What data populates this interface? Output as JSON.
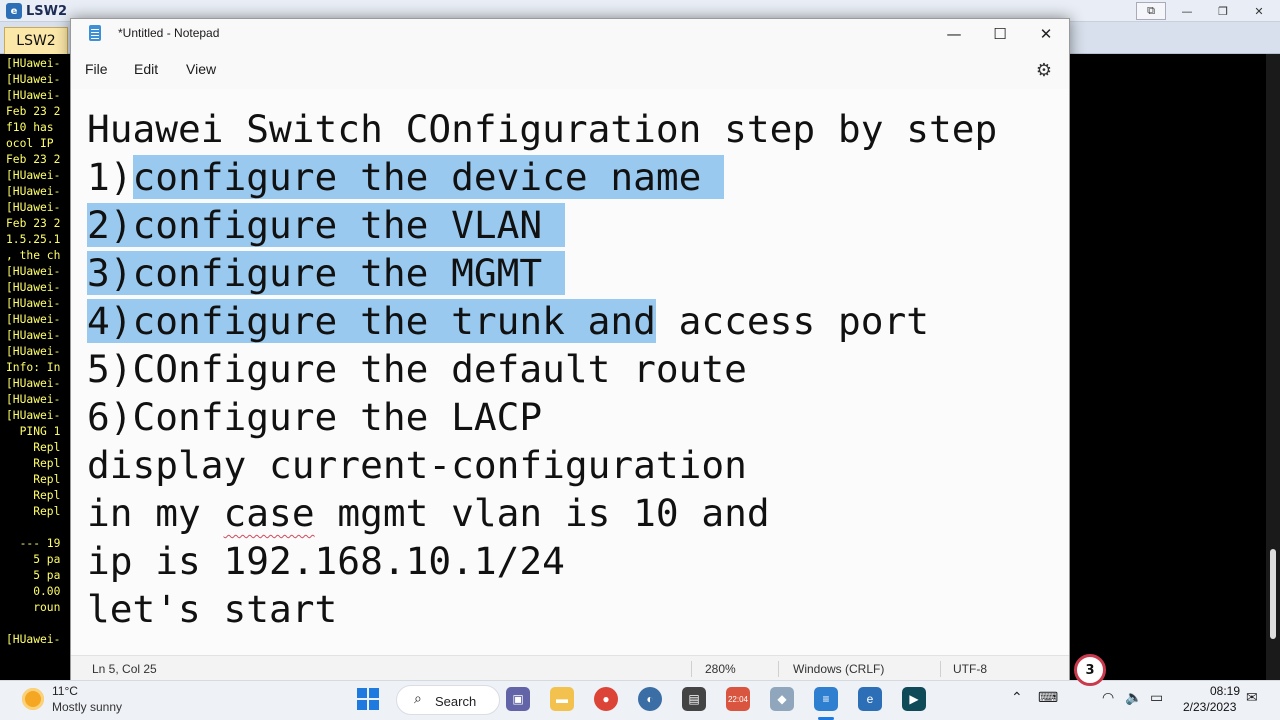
{
  "background_window": {
    "title": "LSW2",
    "tab_label": "LSW2",
    "console_lines": [
      "[HUawei-",
      "[HUawei-",
      "[HUawei-",
      "Feb 23 2",
      "f10 has",
      "ocol IP",
      "Feb 23 2",
      "[HUawei-",
      "[HUawei-",
      "[HUawei-",
      "Feb 23 2",
      "1.5.25.1",
      ", the ch",
      "[HUawei-",
      "[HUawei-",
      "[HUawei-",
      "[HUawei-",
      "[HUawei-",
      "[HUawei-",
      "Info: In",
      "[HUawei-",
      "[HUawei-",
      "[HUawei-",
      "  PING 1",
      "    Repl",
      "    Repl",
      "    Repl",
      "    Repl",
      "    Repl",
      "",
      "  --- 19",
      "    5 pa",
      "    5 pa",
      "    0.00",
      "    roun",
      "",
      "[HUawei-"
    ]
  },
  "notepad": {
    "title": "*Untitled - Notepad",
    "menu": {
      "file": "File",
      "edit": "Edit",
      "view": "View"
    },
    "lines": {
      "l1": "Huawei Switch COnfiguration step by step",
      "l2_sel": "configure the device name ",
      "l3_sel": "2)configure the VLAN ",
      "l4_sel": "3)configure the MGMT ",
      "l5_sel": "4)configure the trunk and",
      "l5_rest": " access port",
      "l6": "5)COnfigure the default route",
      "l7": "6)Configure the LACP",
      "l8": "display current-configuration",
      "l9_a": "in my ",
      "l9_spell": "case",
      "l9_b": " mgmt vlan is 10 and",
      "l10": "ip is 192.168.10.1/24",
      "l11": "let's start",
      "l2_prefix": "1)"
    },
    "status": {
      "position": "Ln 5, Col 25",
      "zoom": "280%",
      "line_ending": "Windows (CRLF)",
      "encoding": "UTF-8"
    }
  },
  "taskbar": {
    "weather_temp": "11°C",
    "weather_condition": "Mostly sunny",
    "search_label": "Search",
    "clock_time": "08:19",
    "clock_date": "2/23/2023",
    "notification_count": "3",
    "app_calendar_label": "22:04"
  },
  "icons": [
    "gear-icon",
    "minimize-icon",
    "maximize-icon",
    "close-icon",
    "search-icon",
    "windows-start-icon",
    "wifi-icon",
    "volume-icon",
    "battery-icon",
    "microphone-icon",
    "chevron-up-icon",
    "keyboard-icon"
  ],
  "colors": {
    "selection": "#99c9ef",
    "console_text": "#ffff6a",
    "accent": "#1f7ae0",
    "badge_ring": "#c83a4c"
  }
}
